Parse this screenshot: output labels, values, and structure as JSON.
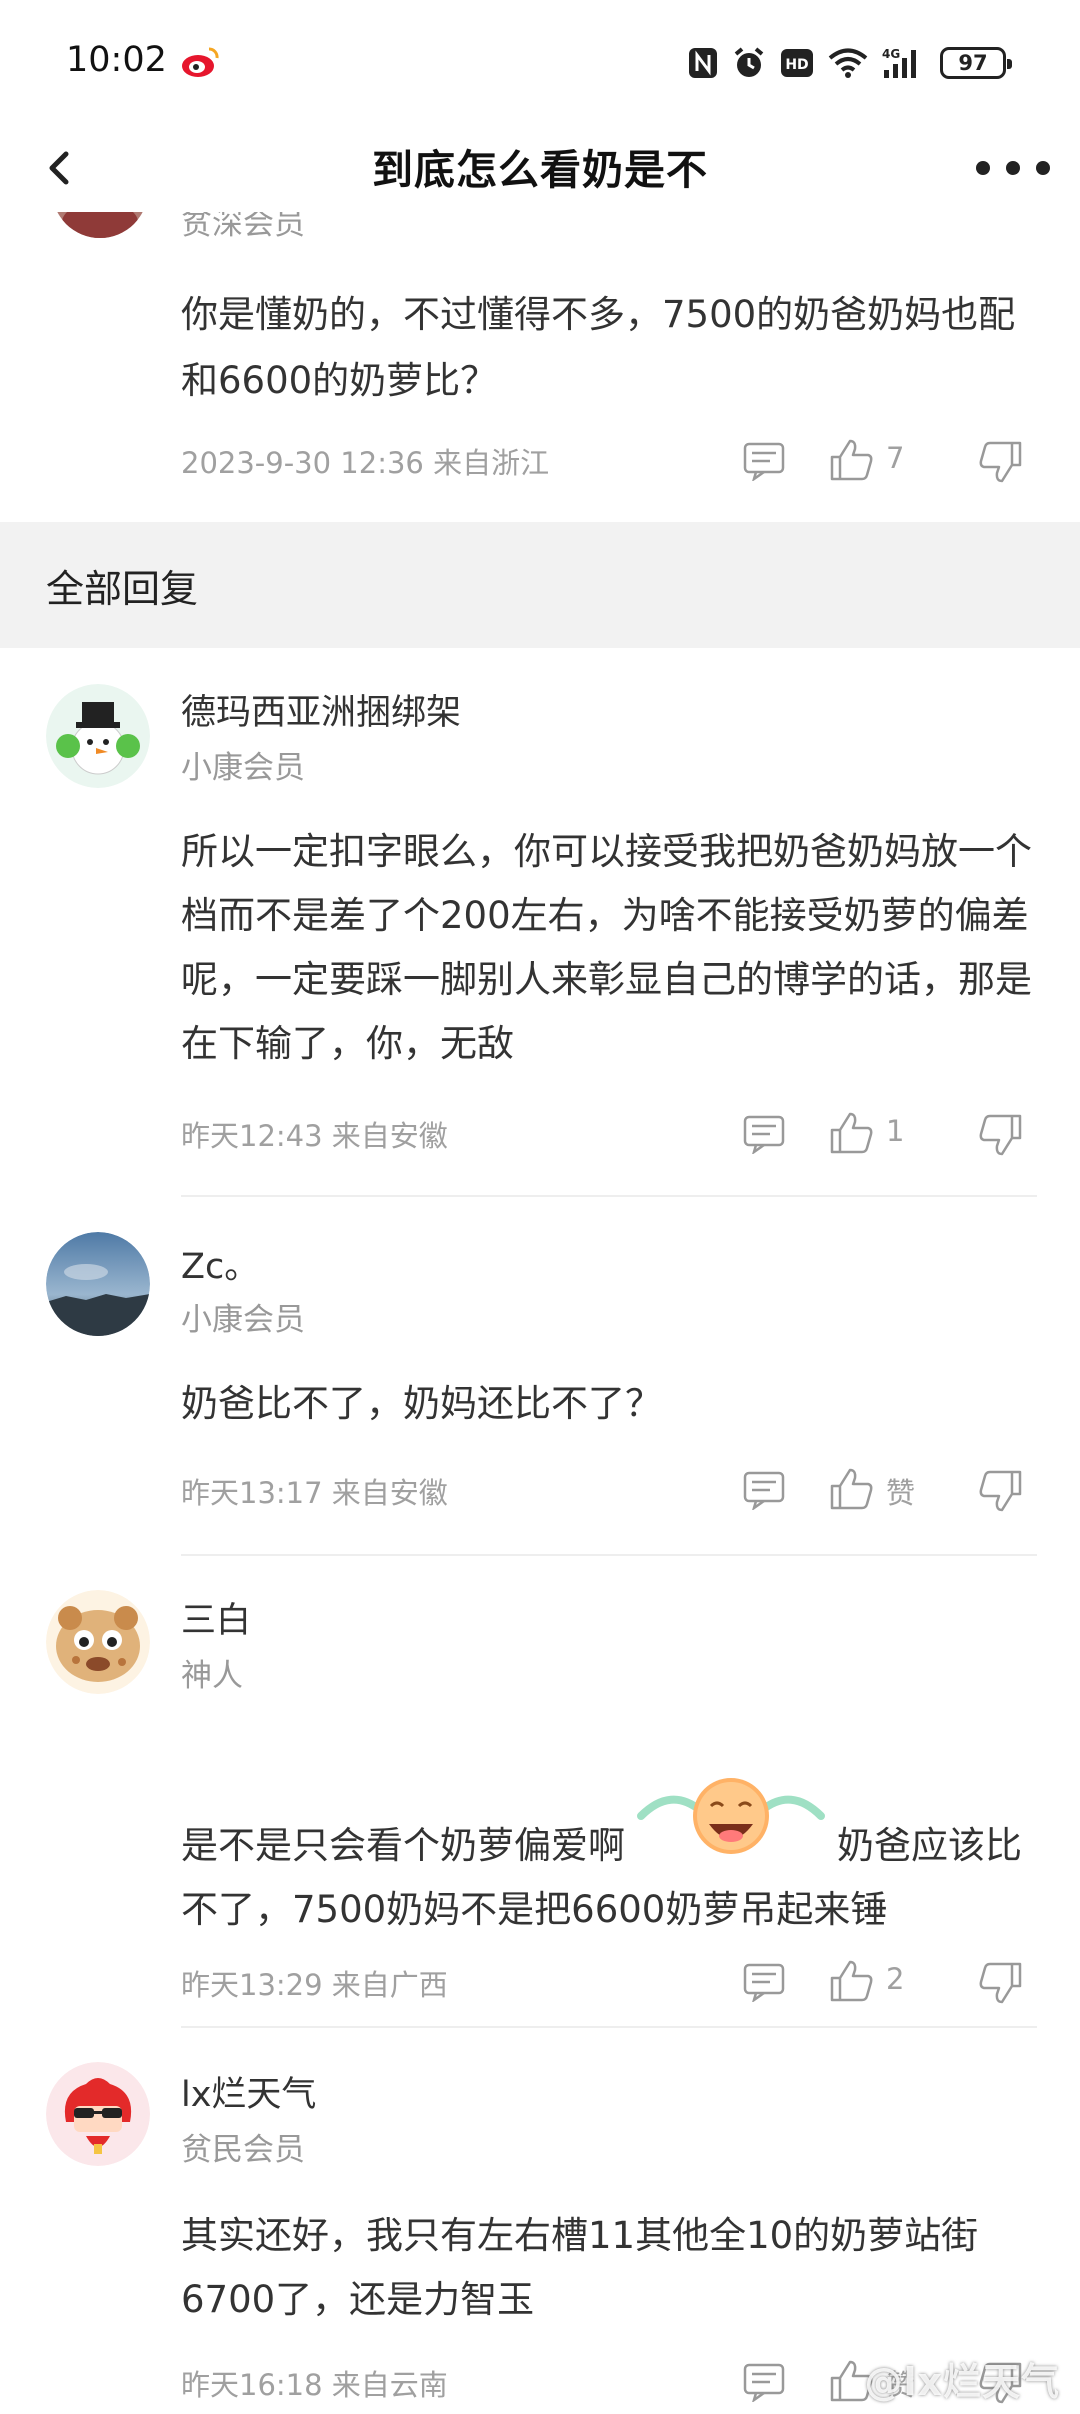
{
  "status_bar": {
    "time": "10:02",
    "battery": "97",
    "network": "4G"
  },
  "nav": {
    "title": "到底怎么看奶是不"
  },
  "top_comment": {
    "level": "贫深会员",
    "text": "你是懂奶的，不过懂得不多，7500的奶爸奶妈也配和6600的奶萝比？",
    "meta": "2023-9-30 12:36  来自浙江",
    "likes": "7"
  },
  "section": {
    "title": "全部回复"
  },
  "comments": [
    {
      "name": "德玛西亚洲捆绑架",
      "level": "小康会员",
      "text": "所以一定扣字眼么，你可以接受我把奶爸奶妈放一个档而不是差了个200左右，为啥不能接受奶萝的偏差呢，一定要踩一脚别人来彰显自己的博学的话，那是在下输了，你，无敌",
      "meta": "昨天12:43 来自安徽",
      "likes": "1"
    },
    {
      "name": "Zc。",
      "level": "小康会员",
      "text": "奶爸比不了，奶妈还比不了？",
      "meta": "昨天13:17 来自安徽",
      "likes": "赞"
    },
    {
      "name": "三白",
      "level": "神人",
      "text_before": "是不是只会看个奶萝偏爱啊",
      "text_after": "奶爸应该比不了，7500奶妈不是把6600奶萝吊起来锤",
      "meta": "昨天13:29 来自广西",
      "likes": "2"
    },
    {
      "name": "lx烂天气",
      "level": "贫民会员",
      "text": "其实还好，我只有左右槽11其他全10的奶萝站街6700了，还是力智玉",
      "meta": "昨天16:18 来自云南",
      "likes": "赞"
    }
  ],
  "watermark": "@lx烂天气",
  "colors": {
    "text": "#333333",
    "meta": "#a0a0a0",
    "section_bg": "#f2f2f2"
  }
}
